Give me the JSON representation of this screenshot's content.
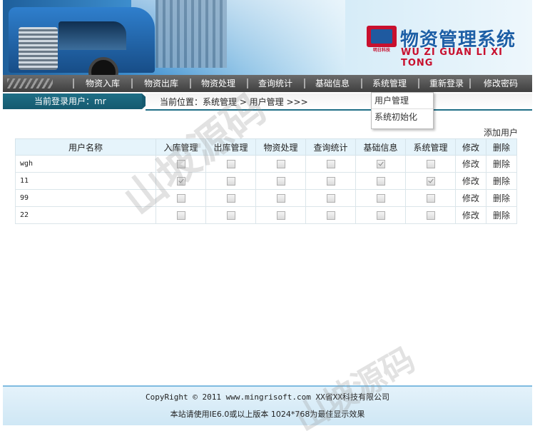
{
  "header": {
    "app_title": "物资管理系统",
    "app_pinyin": "WU ZI GUAN LI XI TONG",
    "logo_text": "明日科技"
  },
  "nav": {
    "items": [
      "物资入库",
      "物资出库",
      "物资处理",
      "查询统计",
      "基础信息",
      "系统管理",
      "重新登录",
      "修改密码"
    ]
  },
  "dropdown": {
    "items": [
      "用户管理",
      "系统初始化"
    ]
  },
  "infobar": {
    "user_label": "当前登录用户：mr",
    "breadcrumb": "当前位置：系统管理 > 用户管理 >>>"
  },
  "content": {
    "add_user": "添加用户",
    "columns": [
      "用户名称",
      "入库管理",
      "出库管理",
      "物资处理",
      "查询统计",
      "基础信息",
      "系统管理",
      "修改",
      "删除"
    ],
    "rows": [
      {
        "name": "wgh",
        "perms": [
          false,
          false,
          false,
          false,
          true,
          false
        ],
        "edit": "修改",
        "delete": "删除"
      },
      {
        "name": "11",
        "perms": [
          true,
          false,
          false,
          false,
          false,
          true
        ],
        "edit": "修改",
        "delete": "删除"
      },
      {
        "name": "99",
        "perms": [
          false,
          false,
          false,
          false,
          false,
          false
        ],
        "edit": "修改",
        "delete": "删除"
      },
      {
        "name": "22",
        "perms": [
          false,
          false,
          false,
          false,
          false,
          false
        ],
        "edit": "修改",
        "delete": "删除"
      }
    ]
  },
  "footer": {
    "copyright": "CopyRight © 2011 www.mingrisoft.com XX省XX科技有限公司",
    "note": "本站请使用IE6.0或以上版本 1024*768为最佳显示效果"
  },
  "watermark": "山坡源码",
  "colors": {
    "nav_bg": "#4a4a4a",
    "accent_teal": "#1f6e86",
    "header_blue": "#1d5fa6",
    "brand_red": "#c8102e"
  }
}
